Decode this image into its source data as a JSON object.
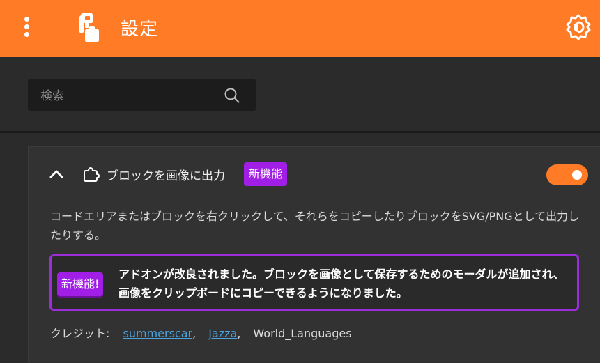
{
  "header": {
    "title": "設定",
    "menu_icon": "more-vertical-icon",
    "logo_icon": "turbowarp-addons-logo",
    "settings_icon": "theme-settings-icon",
    "bg_color": "#ff7b26"
  },
  "search": {
    "placeholder": "検索",
    "value": ""
  },
  "addon": {
    "title": "ブロックを画像に出力",
    "badge": "新機能",
    "enabled": true,
    "description": "コードエリアまたはブロックを右クリックして、それらをコピーしたりブロックをSVG/PNGとして出力したりする。",
    "notice_badge": "新機能!",
    "notice_text": "アドオンが改良されました。ブロックを画像として保存するためのモーダルが追加され、画像をクリップボードにコピーできるようになりました。",
    "credits_label": "クレジット:",
    "credits": [
      {
        "name": "summerscar",
        "link": true
      },
      {
        "name": "Jazza",
        "link": true
      },
      {
        "name": "World_Languages",
        "link": false
      }
    ],
    "credits_separator": ",",
    "accent_color": "#a11ee6"
  }
}
